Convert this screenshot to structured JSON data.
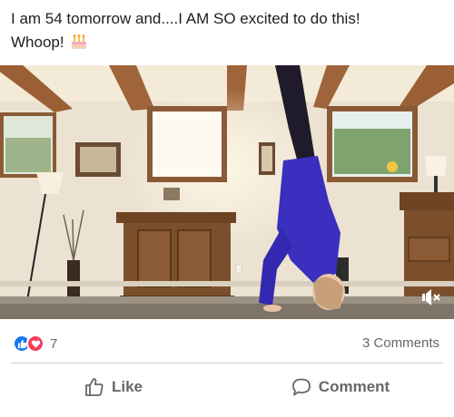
{
  "post": {
    "text_line1": "I am 54 tomorrow and....I AM SO excited to do this!",
    "text_line2": "Whoop!",
    "emoji": "birthday-cake-icon"
  },
  "video": {
    "description_icon": "video-frame",
    "muted": true,
    "mute_icon": "speaker-muted-icon"
  },
  "reactions": {
    "types": [
      "like",
      "love"
    ],
    "count": "7"
  },
  "comments": {
    "label": "3 Comments"
  },
  "actions": {
    "like_label": "Like",
    "comment_label": "Comment"
  },
  "colors": {
    "like_blue": "#1877f2",
    "love_red": "#f33e58",
    "secondary_text": "#65676b",
    "wall": "#eee5d5",
    "beam": "#a0643a",
    "shirt": "#3a2fbf"
  }
}
